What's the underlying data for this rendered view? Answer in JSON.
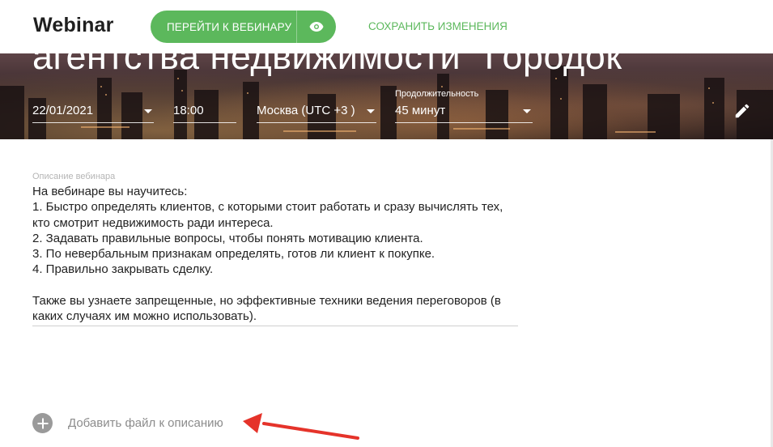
{
  "header": {
    "brand": "Webinar",
    "go_button_label": "ПЕРЕЙТИ К ВЕБИНАРУ",
    "save_label": "СОХРАНИТЬ ИЗМЕНЕНИЯ",
    "accent_color": "#5cb85c"
  },
  "banner": {
    "title": "агентства недвижимости \"Городок\"",
    "date": "22/01/2021",
    "time": "18:00",
    "timezone": "Москва (UTC +3 )",
    "duration_label": "Продолжительность",
    "duration": "45 минут",
    "edit_icon": "pencil-icon"
  },
  "description": {
    "label": "Описание вебинара",
    "text": "На вебинаре вы научитесь:\n1. Быстро определять клиентов, с которыми стоит работать и сразу вычислять тех, кто смотрит недвижимость ради интереса.\n2. Задавать правильные вопросы, чтобы понять мотивацию клиента.\n3. По невербальным признакам определять, готов ли клиент к покупке.\n4. Правильно закрывать сделку.\n\nТакже вы узнаете запрещенные, но эффективные техники ведения переговоров (в каких случаях им можно использовать)."
  },
  "attachments": {
    "add_label": "Добавить файл к описанию",
    "annotation_arrow_color": "#e5332a"
  }
}
